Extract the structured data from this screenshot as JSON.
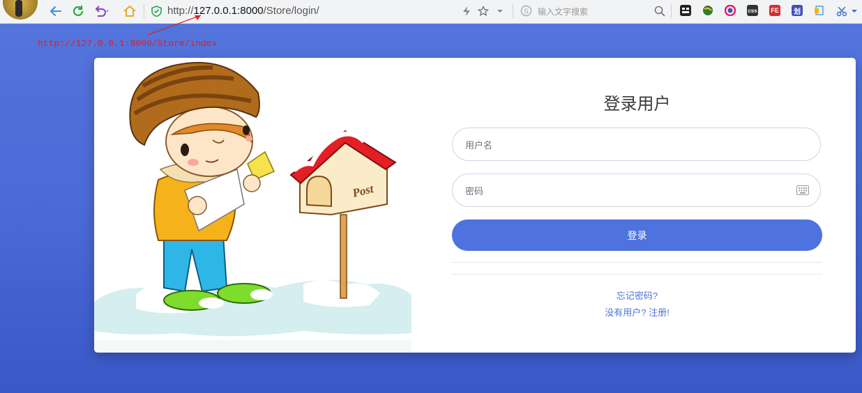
{
  "browser": {
    "url_prefix": "http://",
    "url_host": "127.0.0.1:8000",
    "url_path": "/Store/login/",
    "search_placeholder": "输入文字搜索",
    "extensions": [
      "css",
      "FE",
      "划"
    ]
  },
  "annotation": {
    "text": "http://127.0.0.1:8000/Store/index"
  },
  "illustration": {
    "sign_text": "Post"
  },
  "login": {
    "title": "登录用户",
    "username_placeholder": "用户名",
    "password_placeholder": "密码",
    "submit_label": "登录",
    "forgot_link": "忘记密码?",
    "register_link": "没有用户? 注册!"
  },
  "colors": {
    "background": "#4e73df",
    "button": "#4e73df",
    "annotation": "#e02020"
  }
}
